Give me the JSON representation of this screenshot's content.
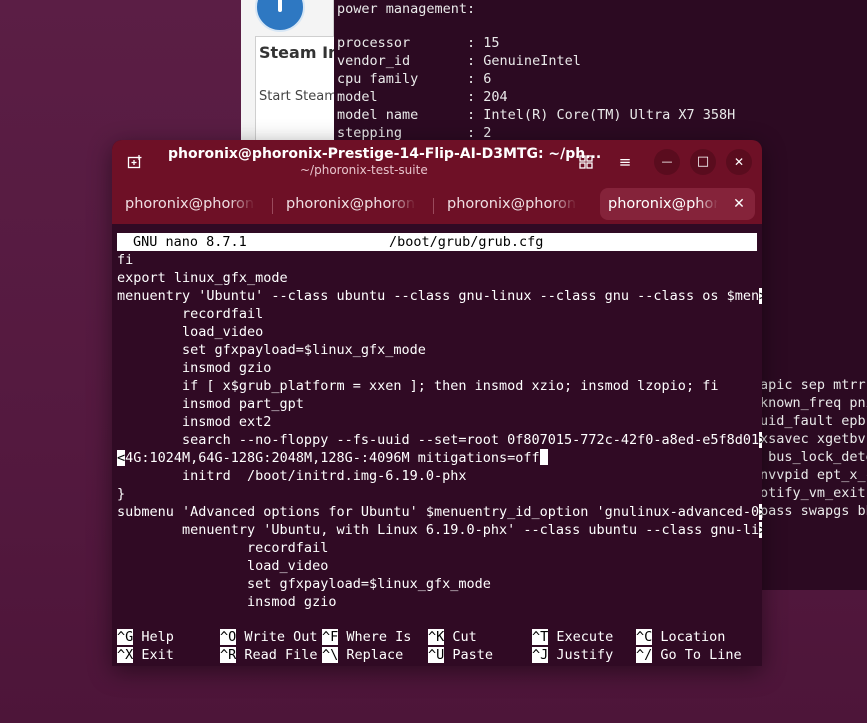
{
  "background_terminal": {
    "lines": [
      "power management:",
      "",
      "processor       : 15",
      "vendor_id       : GenuineIntel",
      "cpu family      : 6",
      "model           : 204",
      "model name      : Intel(R) Core(TM) Ultra X7 358H",
      "stepping        : 2"
    ],
    "right_fragments": [
      "apic sep mtrr",
      "known_freq pni",
      "uid_fault epb",
      "xsavec xgetbv",
      " bus_lock_dete",
      "nvvpid ept_x_c",
      "otify_vm_exit",
      "pass swapgs bh"
    ]
  },
  "steam_dialog": {
    "title": "Steam Installer",
    "subtitle": "Start Steam"
  },
  "window": {
    "title": "phoronix@phoronix-Prestige-14-Flip-AI-D3MTG: ~/ph...",
    "subtitle": "~/phoronix-test-suite",
    "icons": {
      "new_tab": "⊞",
      "split": "⊞",
      "menu": "≡",
      "minimize": "—",
      "maximize": "□",
      "close": "✕"
    }
  },
  "tabs": [
    {
      "label": "phoronix@phoronix-Prestige"
    },
    {
      "label": "phoronix@phoronix-Prestige"
    },
    {
      "label": "phoronix@phoronix-Prestige"
    },
    {
      "label": "phoronix@phoronix-Prestige",
      "active": true,
      "close": "✕"
    }
  ],
  "nano": {
    "version": "GNU nano 8.7.1",
    "file": "/boot/grub/grub.cfg",
    "lines": [
      {
        "text": "fi"
      },
      {
        "text": "export linux_gfx_mode"
      },
      {
        "text": "menuentry 'Ubuntu' --class ubuntu --class gnu-linux --class gnu --class os $men",
        "more": ">"
      },
      {
        "text": "        recordfail"
      },
      {
        "text": "        load_video"
      },
      {
        "text": "        set gfxpayload=$linux_gfx_mode"
      },
      {
        "text": "        insmod gzio"
      },
      {
        "text": "        if [ x$grub_platform = xxen ]; then insmod xzio; insmod lzopio; fi"
      },
      {
        "text": "        insmod part_gpt"
      },
      {
        "text": "        insmod ext2"
      },
      {
        "text": "        search --no-floppy --fs-uuid --set=root 0f807015-772c-42f0-a8ed-e5f8d01",
        "more": ">"
      },
      {
        "prefix": "<",
        "text": "4G:1024M,64G-128G:2048M,128G-:4096M mitigations=off",
        "cursor": true
      },
      {
        "text": "        initrd  /boot/initrd.img-6.19.0-phx"
      },
      {
        "text": "}"
      },
      {
        "text": "submenu 'Advanced options for Ubuntu' $menuentry_id_option 'gnulinux-advanced-0",
        "more": ">"
      },
      {
        "text": "        menuentry 'Ubuntu, with Linux 6.19.0-phx' --class ubuntu --class gnu-li",
        "more": ">"
      },
      {
        "text": "                recordfail"
      },
      {
        "text": "                load_video"
      },
      {
        "text": "                set gfxpayload=$linux_gfx_mode"
      },
      {
        "text": "                insmod gzio"
      }
    ],
    "shortcuts": [
      [
        {
          "key": "^G",
          "label": " Help"
        },
        {
          "key": "^X",
          "label": " Exit"
        }
      ],
      [
        {
          "key": "^O",
          "label": " Write Out"
        },
        {
          "key": "^R",
          "label": " Read File"
        }
      ],
      [
        {
          "key": "^F",
          "label": " Where Is"
        },
        {
          "key": "^\\",
          "label": " Replace"
        }
      ],
      [
        {
          "key": "^K",
          "label": " Cut"
        },
        {
          "key": "^U",
          "label": " Paste"
        }
      ],
      [
        {
          "key": "^T",
          "label": " Execute"
        },
        {
          "key": "^J",
          "label": " Justify"
        }
      ],
      [
        {
          "key": "^C",
          "label": " Location"
        },
        {
          "key": "^/",
          "label": " Go To Line"
        }
      ]
    ]
  }
}
